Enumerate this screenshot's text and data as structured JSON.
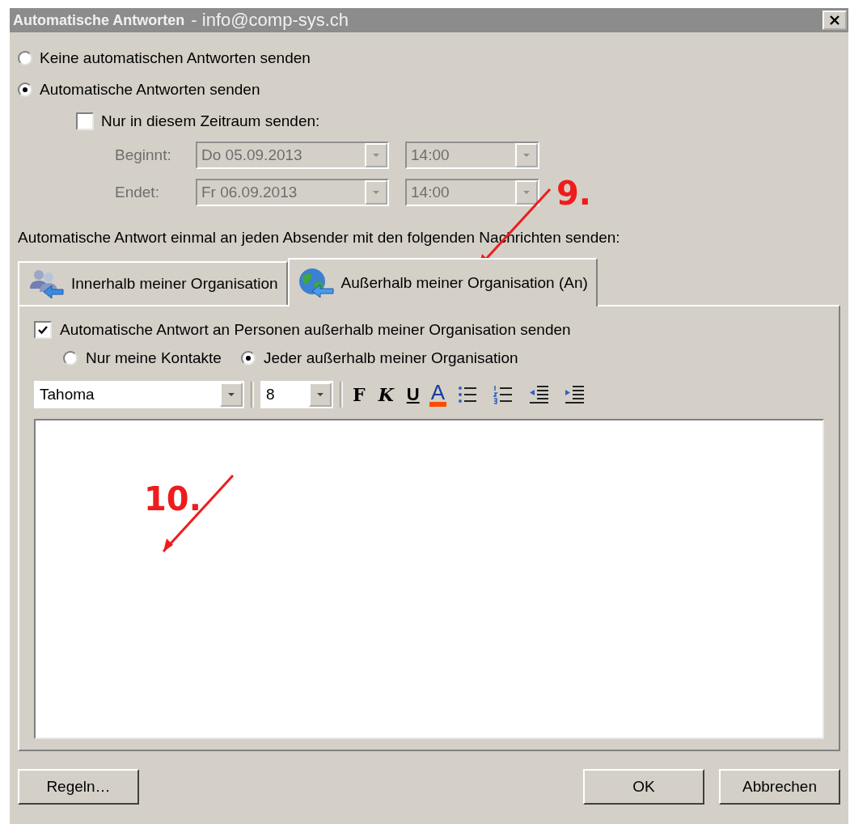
{
  "window": {
    "title": "Automatische Antworten",
    "account": "- info@comp-sys.ch"
  },
  "reply_mode": [
    {
      "label": "Keine automatischen Antworten senden",
      "selected": false
    },
    {
      "label": "Automatische Antworten senden",
      "selected": true
    }
  ],
  "time_range": {
    "label": "Nur in diesem Zeitraum senden:",
    "checked": false,
    "disabled": true,
    "rows": [
      {
        "label": "Beginnt:",
        "date": "Do 05.09.2013",
        "time": "14:00"
      },
      {
        "label": "Endet:",
        "date": "Fr 06.09.2013",
        "time": "14:00"
      }
    ]
  },
  "message_label": "Automatische Antwort einmal an jeden Absender mit den folgenden Nachrichten senden:",
  "tabs": [
    {
      "label": "Innerhalb meiner Organisation",
      "kind": "people",
      "selected": false
    },
    {
      "label": "Außerhalb meiner Organisation (An)",
      "kind": "globe",
      "selected": true
    }
  ],
  "outside": {
    "send": {
      "label": "Automatische Antwort an Personen außerhalb meiner Organisation senden",
      "checked": true
    },
    "audience": [
      {
        "label": "Nur meine Kontakte",
        "selected": false
      },
      {
        "label": "Jeder außerhalb meiner Organisation",
        "selected": true
      }
    ]
  },
  "toolbar": {
    "font": "Tahoma",
    "size": "8",
    "buttons": [
      {
        "kind": "bold",
        "label": "F"
      },
      {
        "kind": "italic",
        "label": "K"
      },
      {
        "kind": "underline",
        "label": "U"
      },
      {
        "kind": "color",
        "label": "A"
      },
      {
        "kind": "bullets"
      },
      {
        "kind": "numbering"
      },
      {
        "kind": "outdent"
      },
      {
        "kind": "indent"
      }
    ]
  },
  "buttons": [
    {
      "label": "Regeln…",
      "kind": "left"
    },
    {
      "label": "OK",
      "kind": "right"
    },
    {
      "label": "Abbrechen",
      "kind": "right"
    }
  ],
  "annotations": [
    {
      "label": "9.",
      "kind": "tab"
    },
    {
      "label": "10.",
      "kind": "editor"
    }
  ]
}
